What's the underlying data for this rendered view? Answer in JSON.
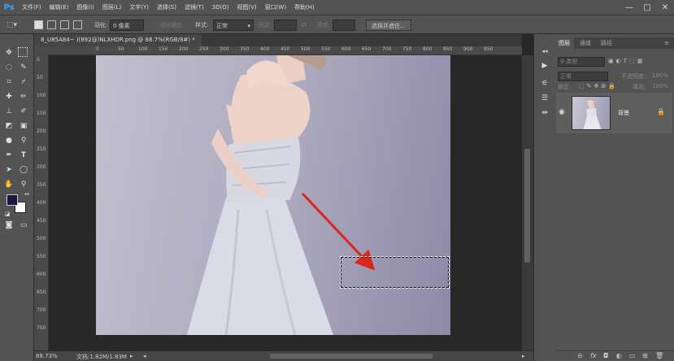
{
  "app": {
    "logo": "Ps"
  },
  "menu": [
    "文件(F)",
    "编辑(E)",
    "图像(I)",
    "图层(L)",
    "文字(Y)",
    "选择(S)",
    "滤镜(T)",
    "3D(D)",
    "视图(V)",
    "窗口(W)",
    "帮助(H)"
  ],
  "window_controls": {
    "minimize": "—",
    "restore": "□",
    "close": "✕"
  },
  "options": {
    "feather_label": "羽化:",
    "feather_value": "0 像素",
    "antialias_label": "消除锯齿",
    "style_label": "样式:",
    "style_value": "正常",
    "width_label": "宽度:",
    "height_label": "高度:",
    "select_mask_button": "选择并遮住..."
  },
  "document": {
    "tab_title": "8_U85A84~ )(892@)NLXHDR.png @ 88.7%(RGB/8#) *",
    "zoom": "88.73%",
    "doc_info": "文档:1.82M/1.83M"
  },
  "rulers": {
    "top": [
      "0",
      "50",
      "100",
      "150",
      "200",
      "250",
      "300",
      "350",
      "400",
      "450",
      "500",
      "550",
      "600",
      "650",
      "700",
      "750",
      "800",
      "850",
      "900",
      "950"
    ],
    "left": [
      "0",
      "50",
      "100",
      "150",
      "200",
      "250",
      "300",
      "350",
      "400",
      "450",
      "500",
      "550",
      "600",
      "650",
      "700",
      "750"
    ]
  },
  "layers_panel": {
    "tabs": [
      "图层",
      "通道",
      "路径"
    ],
    "filter_label": "类型",
    "blend_mode": "正常",
    "opacity_label": "不透明度:",
    "opacity_value": "100%",
    "lock_label": "锁定:",
    "fill_label": "填充:",
    "fill_value": "100%",
    "layer_name": "背景"
  },
  "colors": {
    "selection_arrow": "#d9251c",
    "accent": "#31a8ff",
    "foreground": "#1b1741",
    "background": "#ffffff"
  }
}
